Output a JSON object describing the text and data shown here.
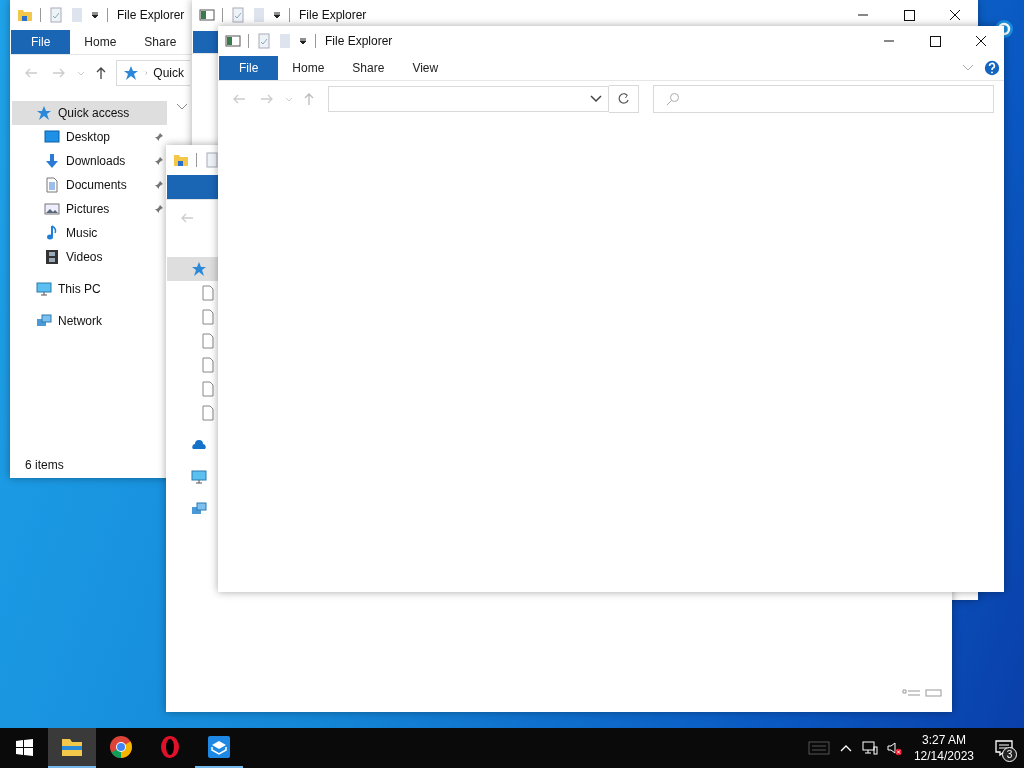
{
  "back_window": {
    "title": "File Explorer",
    "tabs": [
      {
        "label": "File",
        "selected": true
      },
      {
        "label": "Home",
        "selected": false
      },
      {
        "label": "Share",
        "selected": false
      }
    ],
    "address": "Quick",
    "nav": [
      {
        "label": "Quick access",
        "kind": "star",
        "selected": true,
        "children": [
          {
            "label": "Desktop",
            "kind": "desktop",
            "pinned": true
          },
          {
            "label": "Downloads",
            "kind": "downloads",
            "pinned": true
          },
          {
            "label": "Documents",
            "kind": "documents",
            "pinned": true
          },
          {
            "label": "Pictures",
            "kind": "pictures",
            "pinned": true
          },
          {
            "label": "Music",
            "kind": "music",
            "pinned": false
          },
          {
            "label": "Videos",
            "kind": "videos",
            "pinned": false
          }
        ]
      },
      {
        "label": "This PC",
        "kind": "pc",
        "selected": false
      },
      {
        "label": "Network",
        "kind": "network",
        "selected": false
      }
    ],
    "status": "6 items"
  },
  "middle_window": {
    "title": "File Explorer",
    "tabs": [
      {
        "selected": true
      }
    ]
  },
  "side_window": {
    "tabs": [
      {
        "selected": true
      }
    ],
    "nav": [
      {
        "kind": "star",
        "selected": true,
        "children": [
          {
            "kind": "file"
          },
          {
            "kind": "file"
          },
          {
            "kind": "file"
          },
          {
            "kind": "file"
          },
          {
            "kind": "file"
          },
          {
            "kind": "file"
          }
        ]
      },
      {
        "kind": "cloud",
        "selected": false
      },
      {
        "kind": "pc",
        "selected": false
      },
      {
        "kind": "network",
        "selected": false
      }
    ]
  },
  "front_window": {
    "title": "File Explorer",
    "tabs": [
      {
        "label": "File",
        "selected": true
      },
      {
        "label": "Home",
        "selected": false
      },
      {
        "label": "Share",
        "selected": false
      },
      {
        "label": "View",
        "selected": false
      }
    ]
  },
  "taskbar": {
    "apps": [
      {
        "kind": "explorer",
        "running": true,
        "selected": true
      },
      {
        "kind": "chrome",
        "running": false,
        "selected": false
      },
      {
        "kind": "opera",
        "running": false,
        "selected": false
      },
      {
        "kind": "box",
        "running": true,
        "selected": false
      }
    ],
    "muted": true,
    "time": "3:27 AM",
    "date": "12/14/2023",
    "notifications": "3"
  }
}
